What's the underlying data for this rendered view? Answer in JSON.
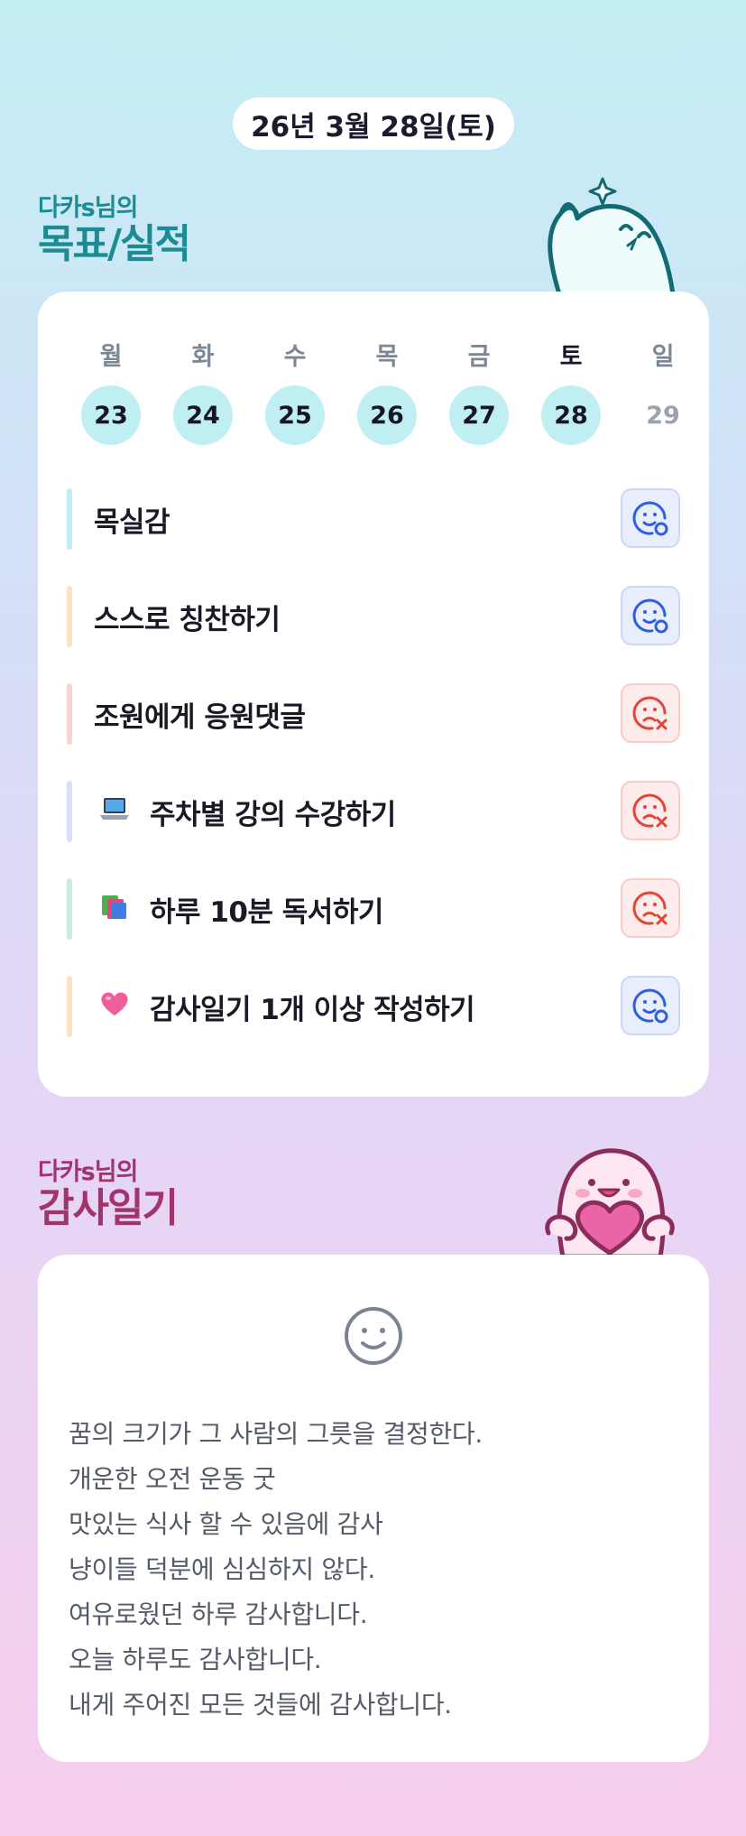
{
  "date": "26년 3월 28일(토)",
  "goals_section": {
    "owner": "다카s님의",
    "title": "목표/실적"
  },
  "week": [
    {
      "dow": "월",
      "num": "23",
      "done": true,
      "today": false
    },
    {
      "dow": "화",
      "num": "24",
      "done": true,
      "today": false
    },
    {
      "dow": "수",
      "num": "25",
      "done": true,
      "today": false
    },
    {
      "dow": "목",
      "num": "26",
      "done": true,
      "today": false
    },
    {
      "dow": "금",
      "num": "27",
      "done": true,
      "today": false
    },
    {
      "dow": "토",
      "num": "28",
      "done": true,
      "today": true
    },
    {
      "dow": "일",
      "num": "29",
      "done": false,
      "today": false
    }
  ],
  "goals": [
    {
      "icon": "",
      "label": "목실감",
      "status": "success",
      "bar_color": "#bdeff3"
    },
    {
      "icon": "",
      "label": "스스로 칭찬하기",
      "status": "success",
      "bar_color": "#fde2c4"
    },
    {
      "icon": "",
      "label": "조원에게 응원댓글",
      "status": "fail",
      "bar_color": "#fbd3d3"
    },
    {
      "icon": "laptop-icon",
      "label": "주차별 강의 수강하기",
      "status": "fail",
      "bar_color": "#d8e0fb"
    },
    {
      "icon": "books-icon",
      "label": "하루 10분 독서하기",
      "status": "fail",
      "bar_color": "#c6efe0"
    },
    {
      "icon": "pink-heart-icon",
      "label": "감사일기 1개 이상 작성하기",
      "status": "success",
      "bar_color": "#fde2c4"
    }
  ],
  "gratitude_section": {
    "owner": "다카s님의",
    "title": "감사일기"
  },
  "gratitude_entries": [
    "꿈의 크기가 그 사람의 그릇을 결정한다.",
    "개운한 오전 운동 굿",
    "맛있는 식사 할 수 있음에 감사",
    "냥이들 덕분에 심심하지 않다.",
    "여유로웠던 하루 감사합니다.",
    "오늘 하루도 감사합니다.",
    "내게 주어진 모든 것들에 감사합니다."
  ],
  "colors": {
    "goal_title": "#1d8b93",
    "gratitude_title": "#a1336f",
    "success_icon": "#2f5fe0",
    "fail_icon": "#e0463a",
    "day_done_bg": "#bfeff2"
  }
}
